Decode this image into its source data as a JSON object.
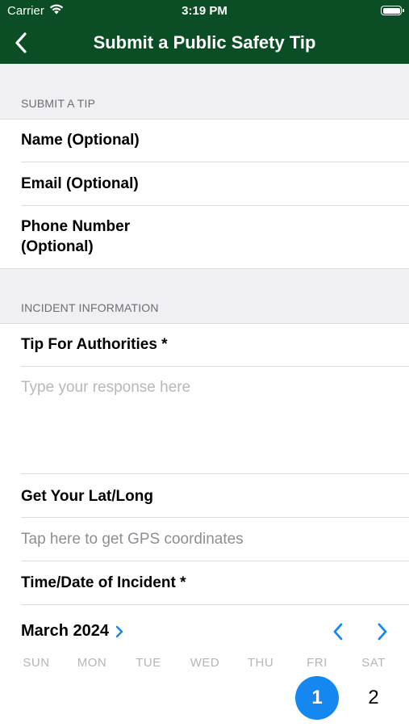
{
  "status_bar": {
    "carrier": "Carrier",
    "time": "3:19 PM"
  },
  "nav": {
    "title": "Submit a Public Safety Tip",
    "back_icon": "chevron-left-icon"
  },
  "sections": {
    "submit": {
      "header": "SUBMIT A TIP",
      "name_label": "Name (Optional)",
      "email_label": "Email (Optional)",
      "phone_label_line1": "Phone Number",
      "phone_label_line2": "(Optional)"
    },
    "incident": {
      "header": "INCIDENT INFORMATION",
      "tip_label": "Tip For Authorities *",
      "tip_placeholder": "Type your response here",
      "latlong_label": "Get Your Lat/Long",
      "gps_hint": "Tap here to get GPS coordinates",
      "datetime_label": "Time/Date of Incident *"
    }
  },
  "calendar": {
    "month": "March 2024",
    "weekdays": [
      "SUN",
      "MON",
      "TUE",
      "WED",
      "THU",
      "FRI",
      "SAT"
    ],
    "visible_days": [
      {
        "day": "1",
        "weekday": "FRI",
        "selected": true
      },
      {
        "day": "2",
        "weekday": "SAT",
        "selected": false
      }
    ]
  },
  "colors": {
    "nav_bg": "#0b4d24",
    "accent": "#1487f0",
    "group_bg": "#efeff4"
  }
}
